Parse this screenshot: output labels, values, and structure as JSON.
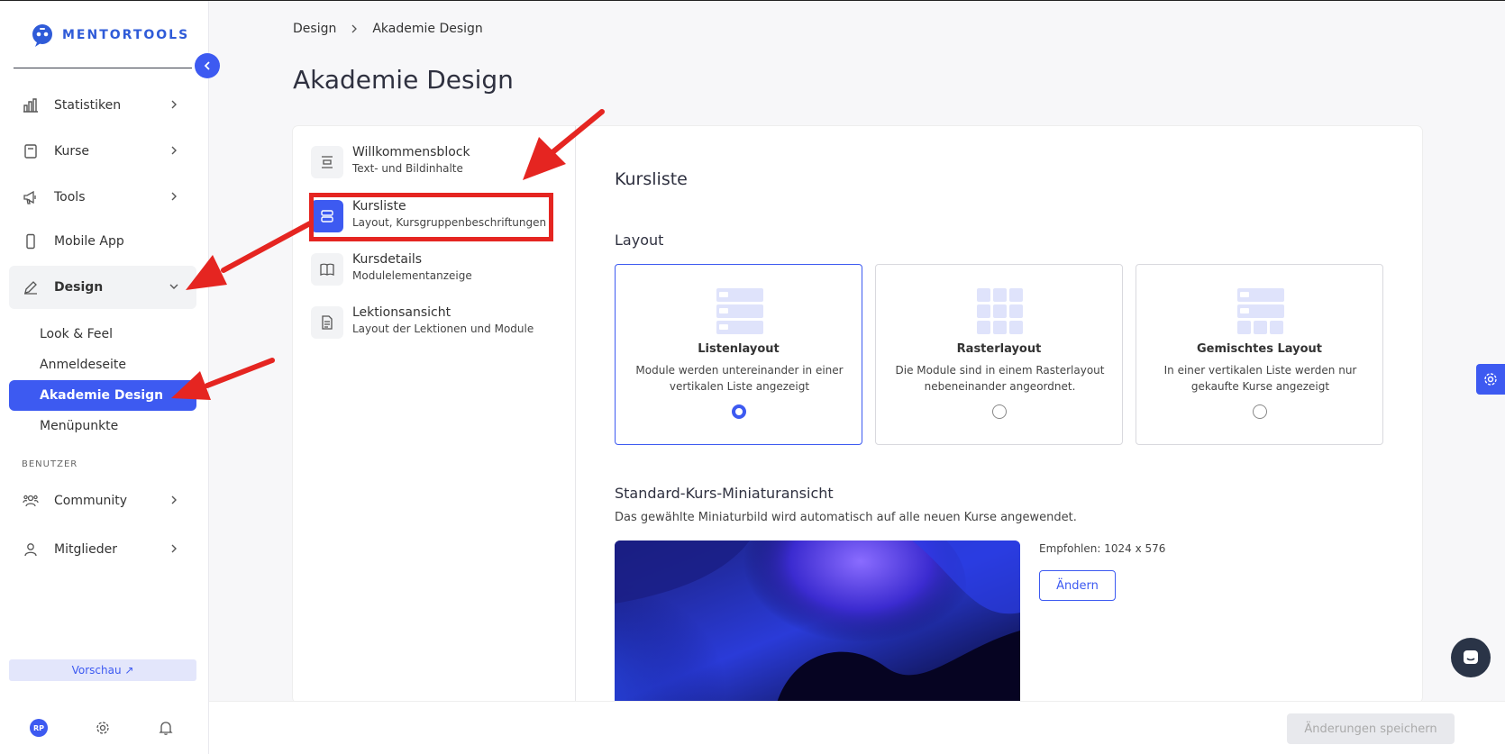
{
  "brand": {
    "name": "MENTORTOOLS",
    "accent": "#3d5af1"
  },
  "sidebar": {
    "collapse_icon": "chevron-left-icon",
    "items": [
      {
        "label": "Statistiken",
        "icon": "bar-chart-icon"
      },
      {
        "label": "Kurse",
        "icon": "book-icon"
      },
      {
        "label": "Tools",
        "icon": "megaphone-icon"
      },
      {
        "label": "Mobile App",
        "icon": "mobile-icon"
      },
      {
        "label": "Design",
        "icon": "pencil-icon"
      }
    ],
    "design_sub": [
      "Look & Feel",
      "Anmeldeseite",
      "Akademie Design",
      "Menüpunkte"
    ],
    "section_label": "BENUTZER",
    "user_items": [
      {
        "label": "Community",
        "icon": "users-icon"
      },
      {
        "label": "Mitglieder",
        "icon": "user-icon"
      }
    ],
    "preview_label": "Vorschau ↗",
    "avatar": "RP"
  },
  "breadcrumb": {
    "parent": "Design",
    "current": "Akademie Design"
  },
  "page_title": "Akademie Design",
  "design_menu": [
    {
      "title": "Willkommensblock",
      "subtitle": "Text- und Bildinhalte"
    },
    {
      "title": "Kursliste",
      "subtitle": "Layout, Kursgruppenbeschriftungen"
    },
    {
      "title": "Kursdetails",
      "subtitle": "Modulelementanzeige"
    },
    {
      "title": "Lektionsansicht",
      "subtitle": "Layout der Lektionen und Module"
    }
  ],
  "content": {
    "heading": "Kursliste",
    "layout_heading": "Layout",
    "layouts": [
      {
        "title": "Listenlayout",
        "desc": "Module werden untereinander in einer vertikalen Liste angezeigt",
        "selected": true
      },
      {
        "title": "Rasterlayout",
        "desc": "Die Module sind in einem Rasterlayout nebeneinander angeordnet.",
        "selected": false
      },
      {
        "title": "Gemischtes Layout",
        "desc": "In einer vertikalen Liste werden nur gekaufte Kurse angezeigt",
        "selected": false
      }
    ],
    "thumb_heading": "Standard-Kurs-Miniaturansicht",
    "thumb_desc": "Das gewählte Miniaturbild wird automatisch auf alle neuen Kurse angewendet.",
    "recommended": "Empfohlen: 1024 x 576",
    "change_label": "Ändern"
  },
  "save_label": "Änderungen speichern"
}
